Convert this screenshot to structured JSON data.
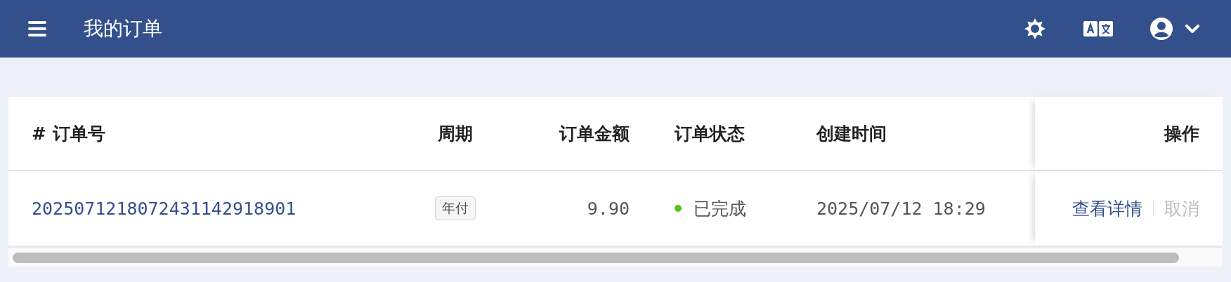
{
  "header": {
    "title": "我的订单"
  },
  "table": {
    "columns": [
      {
        "label": "# 订单号"
      },
      {
        "label": "周期"
      },
      {
        "label": "订单金额"
      },
      {
        "label": "订单状态"
      },
      {
        "label": "创建时间"
      },
      {
        "label": "操作"
      }
    ],
    "rows": [
      {
        "order_no": "2025071218072431142918901",
        "period": "年付",
        "amount": "9.90",
        "status": {
          "label": "已完成",
          "color": "#52c41a"
        },
        "created": "2025/07/12 18:29",
        "actions": [
          {
            "label": "查看详情",
            "disabled": false
          },
          {
            "label": "取消",
            "disabled": true
          }
        ]
      }
    ]
  }
}
